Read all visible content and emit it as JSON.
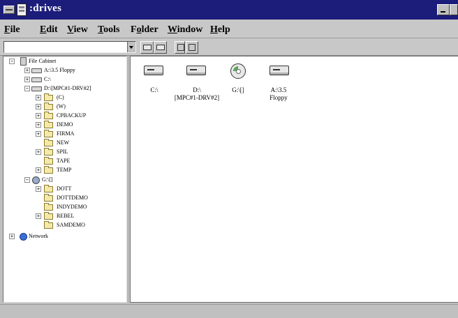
{
  "window": {
    "title": ":drives"
  },
  "menu": {
    "file": {
      "accel": "F",
      "rest": "ile"
    },
    "edit": {
      "accel": "E",
      "rest": "dit"
    },
    "view": {
      "accel": "V",
      "rest": "iew"
    },
    "tools": {
      "accel": "T",
      "rest": "ools"
    },
    "folder": {
      "pre": "F",
      "accel": "o",
      "rest": "lder"
    },
    "window": {
      "accel": "W",
      "rest": "indow"
    },
    "help": {
      "accel": "H",
      "rest": "elp"
    }
  },
  "toolbar": {
    "path_value": ""
  },
  "tree": {
    "root": "File Cabinet",
    "a_drive": "A:\\3.5 Floppy",
    "c_drive": "C:\\",
    "d_drive": "D:\\[MPC#1-DRV#2]",
    "d_children": [
      "(C)",
      "(W)",
      "CPBACKUP",
      "DEMO",
      "FIRMA",
      "NEW",
      "SPIL",
      "TAPE",
      "TEMP"
    ],
    "g_drive": "G:\\[]",
    "g_children": [
      "DOTT",
      "DOTTDEMO",
      "INDYDEMO",
      "REBEL",
      "SAMDEMO"
    ],
    "network": "Network"
  },
  "content": {
    "items": [
      {
        "label": "C:\\"
      },
      {
        "label": "D:\\",
        "label2": "[MPC#1-DRV#2]"
      },
      {
        "label": "G:\\[]"
      },
      {
        "label": "A:\\3.5",
        "label2": "Floppy"
      }
    ]
  },
  "colors": {
    "titlebar": "#1c1c7a",
    "window_face": "#c0c0c0",
    "pane": "#ffffff",
    "folder": "#f4e9a8"
  },
  "icons": {
    "cabinet": "file-cabinet-icon",
    "drive": "hard-drive-icon",
    "floppy": "floppy-drive-icon",
    "cd": "cd-drive-icon",
    "folder": "folder-icon",
    "network": "network-globe-icon"
  }
}
